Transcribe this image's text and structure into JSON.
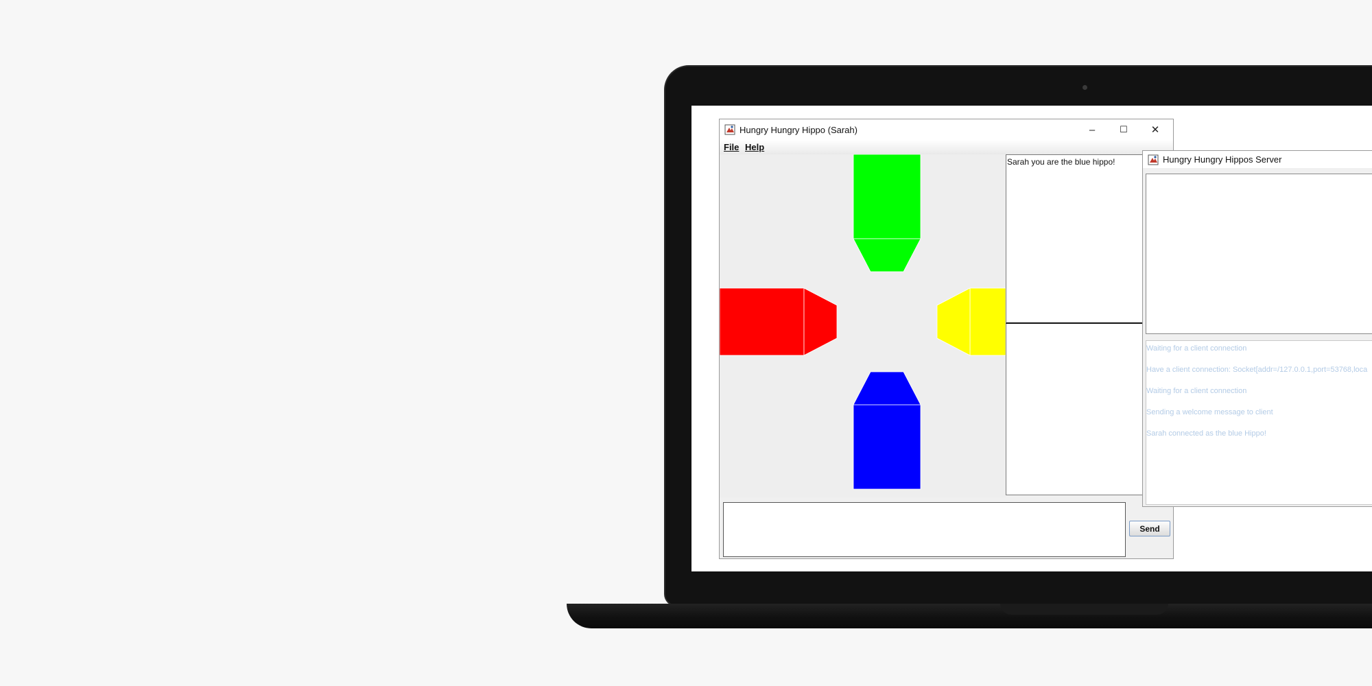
{
  "client": {
    "title": "Hungry Hungry Hippo (Sarah)",
    "controls": {
      "minimize": "–",
      "maximize": "☐",
      "close": "✕"
    },
    "menu": [
      "File",
      "Help"
    ],
    "chat_message": "Sarah you are the blue hippo!",
    "input_value": "",
    "send_label": "Send"
  },
  "hippos": [
    {
      "name": "green",
      "color": "#00ff00",
      "position": "top"
    },
    {
      "name": "red",
      "color": "#ff0000",
      "position": "left"
    },
    {
      "name": "yellow",
      "color": "#ffff00",
      "position": "right"
    },
    {
      "name": "blue",
      "color": "#0000ff",
      "position": "bottom"
    }
  ],
  "server": {
    "title": "Hungry Hungry Hippos Server",
    "log": [
      "Waiting for a client connection",
      "Have a client connection: Socket[addr=/127.0.0.1,port=53768,loca",
      "Waiting for a client connection",
      "Sending a welcome message to client",
      "Sarah connected as the blue Hippo!"
    ]
  }
}
